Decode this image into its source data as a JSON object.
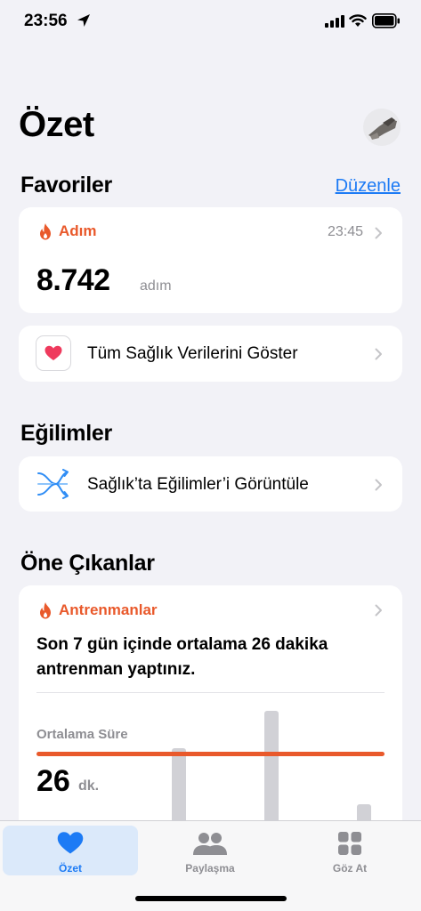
{
  "status_bar": {
    "time": "23:56"
  },
  "header": {
    "title": "Özet"
  },
  "favorites": {
    "title": "Favoriler",
    "edit_label": "Düzenle",
    "steps": {
      "label": "Adım",
      "time": "23:45",
      "value": "8.742",
      "unit": "adım"
    },
    "all_data_label": "Tüm Sağlık Verilerini Göster"
  },
  "trends": {
    "title": "Eğilimler",
    "view_label": "Sağlık’ta Eğilimler’i Görüntüle"
  },
  "highlights": {
    "title": "Öne Çıkanlar",
    "workouts": {
      "label": "Antrenmanlar",
      "description": "Son 7 gün içinde ortalama 26 dakika antrenman yaptınız.",
      "average_label": "Ortalama Süre",
      "average_value": "26",
      "average_unit": "dk."
    }
  },
  "tab_bar": {
    "items": [
      {
        "label": "Özet",
        "active": true,
        "icon": "heart-icon"
      },
      {
        "label": "Paylaşma",
        "active": false,
        "icon": "people-icon"
      },
      {
        "label": "Göz At",
        "active": false,
        "icon": "grid-icon"
      }
    ]
  },
  "colors": {
    "accent_blue": "#1d7bf5",
    "activity_orange": "#e9592b",
    "background": "#f2f2f7"
  }
}
